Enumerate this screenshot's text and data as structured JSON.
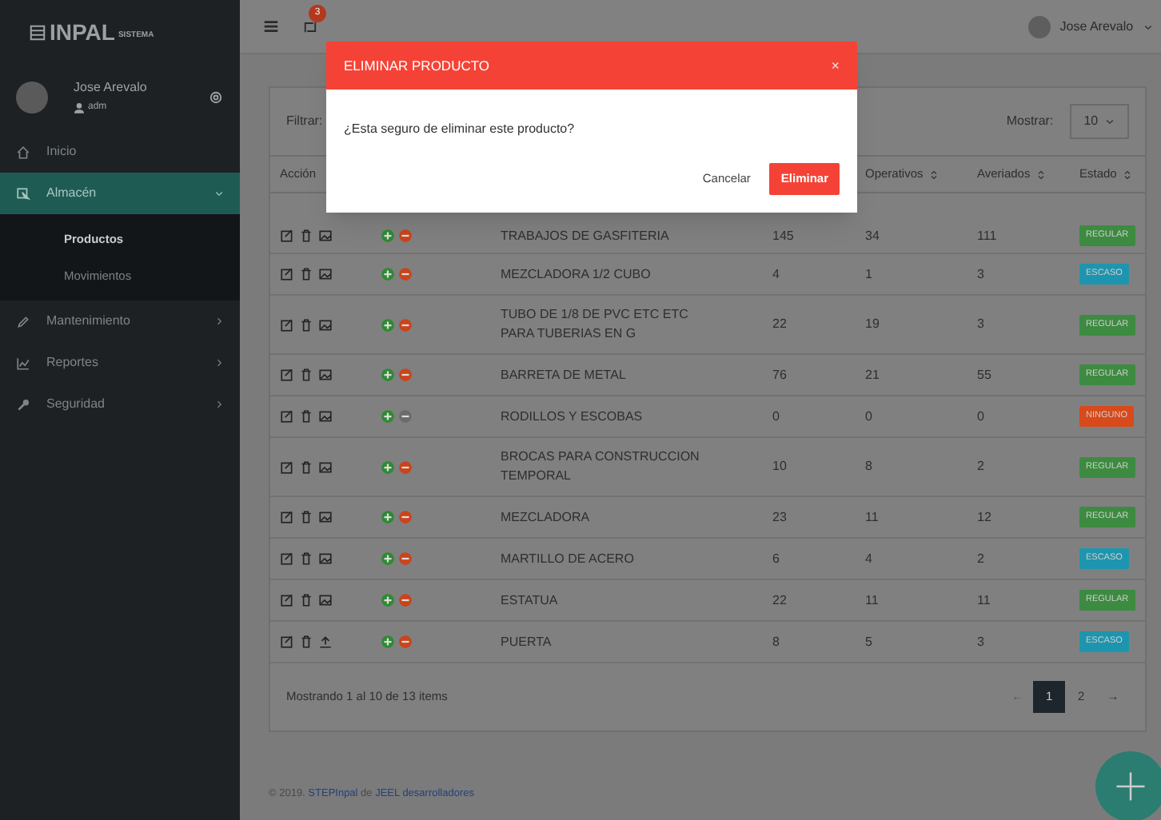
{
  "sidebar": {
    "logo": {
      "name": "INPAL",
      "suffix": "SISTEMA"
    },
    "user": {
      "name": "Jose Arevalo",
      "role": "adm"
    },
    "items": [
      {
        "label": "Inicio",
        "selected": false
      },
      {
        "label": "Almacén",
        "selected": true,
        "expanded": true,
        "has_children": true,
        "children": [
          {
            "label": "Productos",
            "selected": true
          },
          {
            "label": "Movimientos",
            "selected": false
          }
        ]
      },
      {
        "label": "Mantenimiento",
        "selected": false,
        "expanded": false,
        "has_children": true
      },
      {
        "label": "Reportes",
        "selected": false,
        "expanded": false,
        "has_children": true
      },
      {
        "label": "Seguridad",
        "selected": false,
        "expanded": false,
        "has_children": true
      }
    ]
  },
  "header": {
    "notification_count": "3",
    "user_name": "Jose Arevalo"
  },
  "filter": {
    "label": "Filtrar:"
  },
  "page_size": {
    "label": "Mostrar:",
    "value": "10"
  },
  "table": {
    "columns": [
      "Acción",
      "Operativos",
      "Averiados",
      "Estado"
    ],
    "rows": [
      {
        "kind": "image",
        "remove_disabled": false,
        "name": "TRABAJOS DE GASFITERIA",
        "stock": "145",
        "operativos": "34",
        "averiados": "111",
        "status": {
          "label": "REGULAR",
          "color": "#3d8b40"
        }
      },
      {
        "kind": "image",
        "remove_disabled": false,
        "name": "MEZCLADORA 1/2 CUBO",
        "stock": "4",
        "operativos": "1",
        "averiados": "3",
        "status": {
          "label": "ESCASO",
          "color": "#1e95ae"
        }
      },
      {
        "kind": "image",
        "remove_disabled": false,
        "name": "TUBO DE 1/8 DE PVC ETC ETC PARA TUBERIAS EN G",
        "stock": "22",
        "operativos": "19",
        "averiados": "3",
        "status": {
          "label": "REGULAR",
          "color": "#3d8b40"
        }
      },
      {
        "kind": "image",
        "remove_disabled": false,
        "name": "BARRETA DE METAL",
        "stock": "76",
        "operativos": "21",
        "averiados": "55",
        "status": {
          "label": "REGULAR",
          "color": "#3d8b40"
        }
      },
      {
        "kind": "image",
        "remove_disabled": true,
        "name": "RODILLOS Y ESCOBAS",
        "stock": "0",
        "operativos": "0",
        "averiados": "0",
        "status": {
          "label": "NINGUNO",
          "color": "#d84a1b"
        }
      },
      {
        "kind": "image",
        "remove_disabled": false,
        "name": "BROCAS PARA CONSTRUCCION TEMPORAL",
        "stock": "10",
        "operativos": "8",
        "averiados": "2",
        "status": {
          "label": "REGULAR",
          "color": "#3d8b40"
        }
      },
      {
        "kind": "image",
        "remove_disabled": false,
        "name": "MEZCLADORA",
        "stock": "23",
        "operativos": "11",
        "averiados": "12",
        "status": {
          "label": "REGULAR",
          "color": "#3d8b40"
        }
      },
      {
        "kind": "image",
        "remove_disabled": false,
        "name": "MARTILLO DE ACERO",
        "stock": "6",
        "operativos": "4",
        "averiados": "2",
        "status": {
          "label": "ESCASO",
          "color": "#1e95ae"
        }
      },
      {
        "kind": "image",
        "remove_disabled": false,
        "name": "ESTATUA",
        "stock": "22",
        "operativos": "11",
        "averiados": "11",
        "status": {
          "label": "REGULAR",
          "color": "#3d8b40"
        }
      },
      {
        "kind": "upload",
        "remove_disabled": false,
        "name": "PUERTA",
        "stock": "8",
        "operativos": "5",
        "averiados": "3",
        "status": {
          "label": "ESCASO",
          "color": "#1e95ae"
        }
      }
    ]
  },
  "summary": "Mostrando 1 al 10 de 13 items",
  "pagination": {
    "prev": "←",
    "next": "→",
    "pages": [
      {
        "label": "1",
        "selected": true
      },
      {
        "label": "2",
        "selected": false
      }
    ]
  },
  "footer": {
    "text": "© 2019.",
    "link": "STEPInpal",
    "middle": "de",
    "author": "JEEL desarrolladores"
  },
  "modal": {
    "title": "ELIMINAR PRODUCTO",
    "close": "×",
    "message": "¿Esta seguro de eliminar este producto?",
    "cancel": "Cancelar",
    "confirm": "Eliminar"
  }
}
